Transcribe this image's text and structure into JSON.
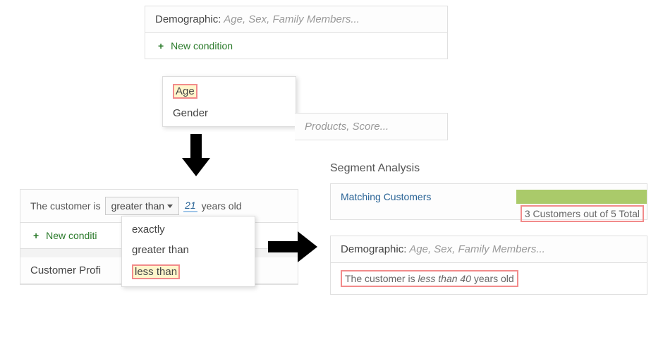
{
  "top_panel": {
    "category_label": "Demographic:",
    "category_hint": "Age, Sex, Family Members...",
    "new_condition": "New condition",
    "dropdown": {
      "age": "Age",
      "gender": "Gender"
    },
    "second_hint_fragment": "Products, Score..."
  },
  "middle_panel": {
    "prefix": "The customer is",
    "selected_op": "greater than",
    "age_value": "21",
    "age_suffix": "years old",
    "new_condition": "New conditi",
    "op_options": {
      "exactly": "exactly",
      "greater": "greater than",
      "less": "less than"
    },
    "cust_profile": "Customer Profi"
  },
  "right_panel": {
    "title": "Segment Analysis",
    "matching": "Matching Customers",
    "result_count": "3 Customers",
    "result_total": "out of 5 Total",
    "demo_label": "Demographic:",
    "demo_hint": "Age, Sex, Family Members...",
    "cond_prefix": "The customer is",
    "cond_op": "less than",
    "cond_val": "40",
    "cond_suffix": "years old"
  }
}
